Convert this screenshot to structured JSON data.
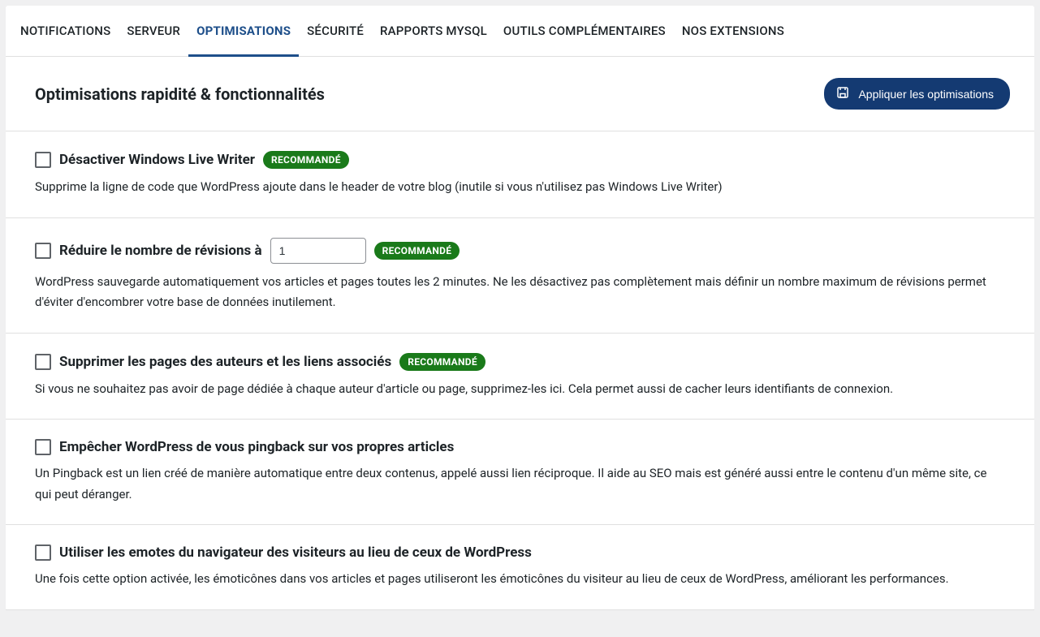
{
  "tabs": [
    {
      "label": "NOTIFICATIONS",
      "active": false
    },
    {
      "label": "SERVEUR",
      "active": false
    },
    {
      "label": "OPTIMISATIONS",
      "active": true
    },
    {
      "label": "SÉCURITÉ",
      "active": false
    },
    {
      "label": "RAPPORTS MYSQL",
      "active": false
    },
    {
      "label": "OUTILS COMPLÉMENTAIRES",
      "active": false
    },
    {
      "label": "NOS EXTENSIONS",
      "active": false
    }
  ],
  "header": {
    "title": "Optimisations rapidité & fonctionnalités",
    "apply_button": "Appliquer les optimisations"
  },
  "badge_recommended": "RECOMMANDÉ",
  "options": [
    {
      "title": "Désactiver Windows Live Writer",
      "recommended": true,
      "desc": "Supprime la ligne de code que WordPress ajoute dans le header de votre blog (inutile si vous n'utilisez pas Windows Live Writer)"
    },
    {
      "title": "Réduire le nombre de révisions à",
      "recommended": true,
      "has_input": true,
      "input_value": "1",
      "desc": "WordPress sauvegarde automatiquement vos articles et pages toutes les 2 minutes. Ne les désactivez pas complètement mais définir un nombre maximum de révisions permet d'éviter d'encombrer votre base de données inutilement."
    },
    {
      "title": "Supprimer les pages des auteurs et les liens associés",
      "recommended": true,
      "desc": "Si vous ne souhaitez pas avoir de page dédiée à chaque auteur d'article ou page, supprimez-les ici. Cela permet aussi de cacher leurs identifiants de connexion."
    },
    {
      "title": "Empêcher WordPress de vous pingback sur vos propres articles",
      "recommended": false,
      "desc": "Un Pingback est un lien créé de manière automatique entre deux contenus, appelé aussi lien réciproque. Il aide au SEO mais est généré aussi entre le contenu d'un même site, ce qui peut déranger."
    },
    {
      "title": "Utiliser les emotes du navigateur des visiteurs au lieu de ceux de WordPress",
      "recommended": false,
      "desc": "Une fois cette option activée, les émoticônes dans vos articles et pages utiliseront les émoticônes du visiteur au lieu de ceux de WordPress, améliorant les performances."
    }
  ]
}
